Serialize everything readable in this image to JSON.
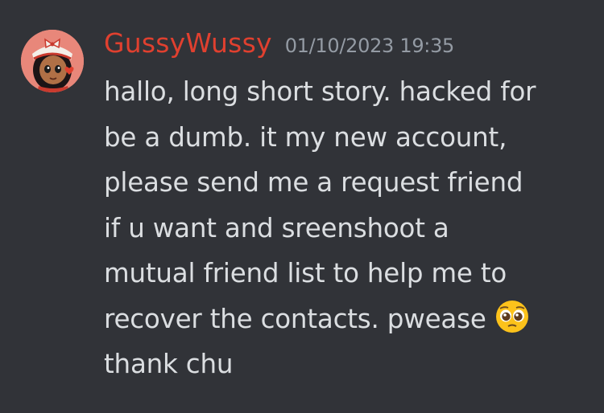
{
  "message": {
    "username": "GussyWussy",
    "timestamp": "01/10/2023 19:35",
    "lines": [
      "hallo, long short story. hacked for",
      "be a dumb. it my new account,",
      "please send me a request friend",
      "if u want and sreenshoot a",
      "mutual friend list to help me to",
      "recover the contacts. pwease",
      "thank chu"
    ],
    "emoji": "pleading-face-emoji",
    "avatar_icon": "avatar-girl-with-bow"
  },
  "colors": {
    "background": "#313338",
    "username": "#e0402f",
    "timestamp": "#949ba4",
    "text": "#dbdee1",
    "emoji": "#fcc21b"
  }
}
